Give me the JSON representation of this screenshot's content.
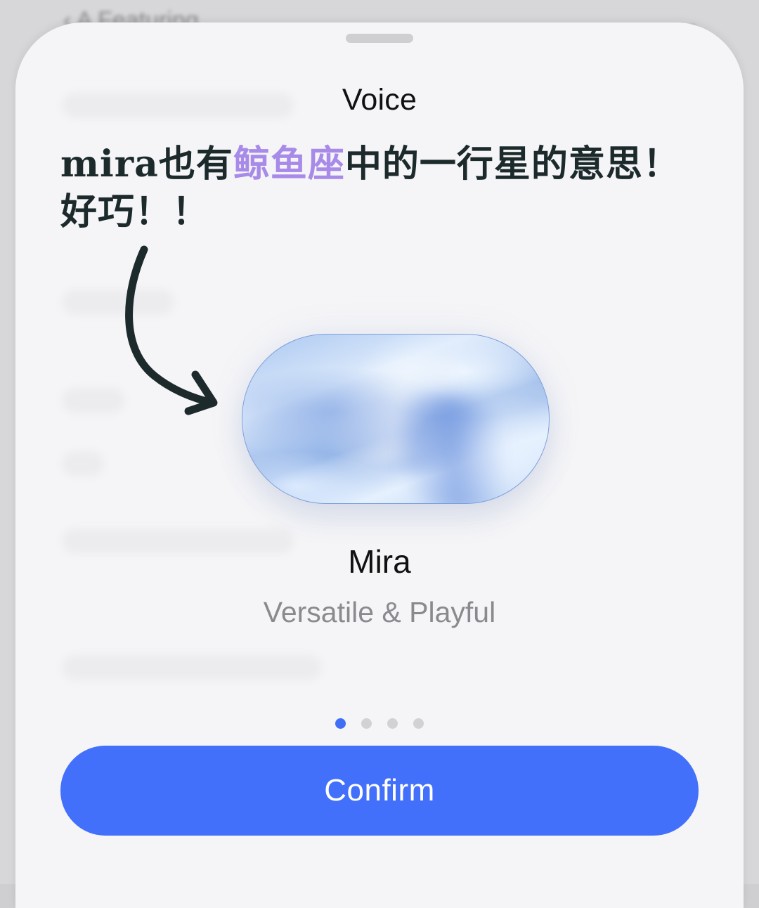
{
  "background_app": {
    "header_text": "‹ A   Featuring",
    "chevron": "›"
  },
  "sheet": {
    "title": "Voice"
  },
  "annotation": {
    "line1_part1": "mira也有",
    "line1_highlight": "鲸鱼座",
    "line1_part2": "中的一行星的意思！",
    "line2": "好巧！！",
    "highlight_color": "#a88ae8"
  },
  "voice": {
    "name": "Mira",
    "description": "Versatile & Playful"
  },
  "pager": {
    "total": 4,
    "active_index": 0,
    "active_color": "#3f6ff5"
  },
  "actions": {
    "confirm_label": "Confirm",
    "confirm_color": "#4370fb"
  },
  "icons": {
    "arrow": "curved-arrow-icon"
  }
}
